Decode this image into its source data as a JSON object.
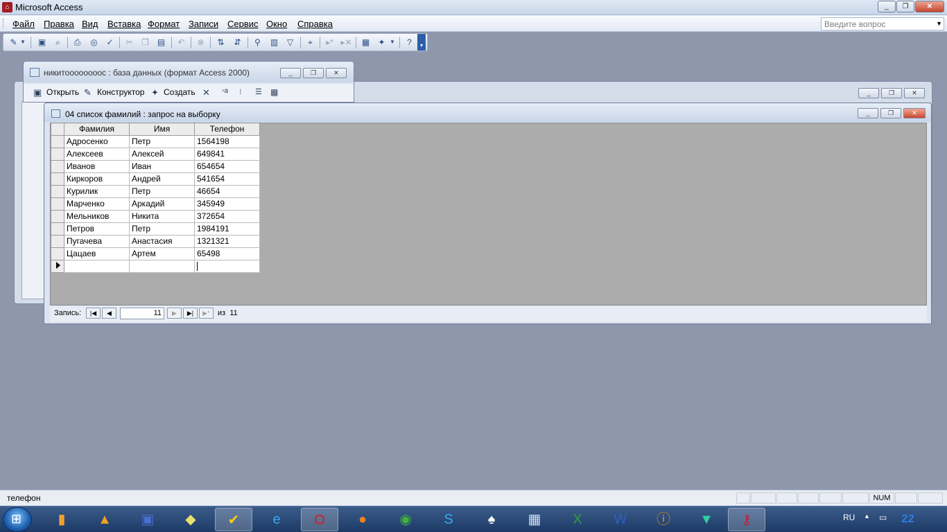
{
  "app": {
    "title": "Microsoft Access"
  },
  "menu": [
    "Файл",
    "Правка",
    "Вид",
    "Вставка",
    "Формат",
    "Записи",
    "Сервис",
    "Окно",
    "Справка"
  ],
  "help": {
    "placeholder": "Введите вопрос"
  },
  "db_window": {
    "title": "никитоооооооос : база данных (формат Access 2000)",
    "open_label": "Открыть",
    "design_label": "Конструктор",
    "create_label": "Создать"
  },
  "query_window": {
    "title": "04 список фамилий : запрос на выборку",
    "columns": [
      "Фамилия",
      "Имя",
      "Телефон"
    ],
    "rows": [
      [
        "Адросенко",
        "Петр",
        "1564198"
      ],
      [
        "Алексеев",
        "Алексей",
        "649841"
      ],
      [
        "Иванов",
        "Иван",
        "654654"
      ],
      [
        "Киркоров",
        "Андрей",
        "541654"
      ],
      [
        "Курилик",
        "Петр",
        "46654"
      ],
      [
        "Марченко",
        "Аркадий",
        "345949"
      ],
      [
        "Мельников",
        "Никита",
        "372654"
      ],
      [
        "Петров",
        "Петр",
        "1984191"
      ],
      [
        "Пугачева",
        "Анастасия",
        "1321321"
      ],
      [
        "Цацаев",
        "Артем",
        "65498"
      ]
    ],
    "nav": {
      "label": "Запись:",
      "current": "11",
      "of_label": "из",
      "total": "11"
    }
  },
  "status": {
    "text": "телефон",
    "num": "NUM"
  },
  "taskbar": {
    "lang": "RU",
    "clock": "22"
  }
}
